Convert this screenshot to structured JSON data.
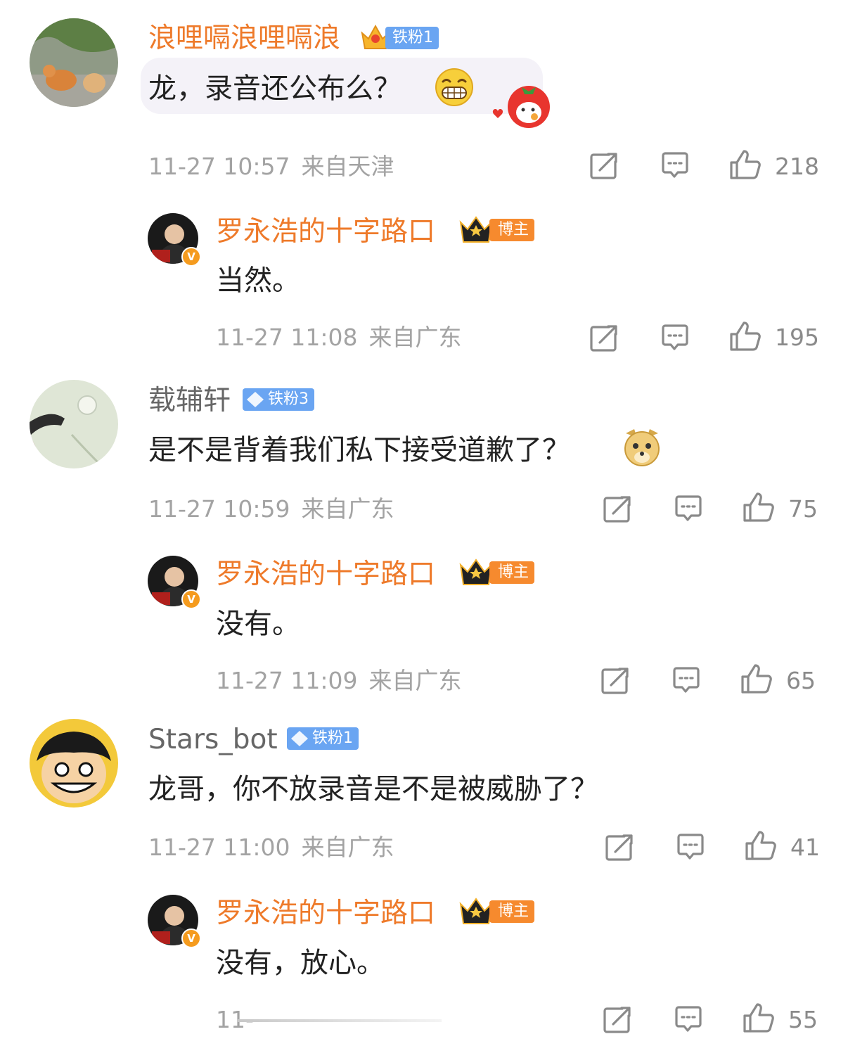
{
  "comments": [
    {
      "user": "浪哩嗝浪哩嗝浪",
      "badge": "铁粉1",
      "text": "龙，录音还公布么？",
      "time": "11-27 10:57",
      "location": "来自天津",
      "likes": "218",
      "reply": {
        "user": "罗永浩的十字路口",
        "badge": "博主",
        "text": "当然。",
        "time": "11-27 11:08",
        "location": "来自广东",
        "likes": "195"
      }
    },
    {
      "user": "载辅轩",
      "badge": "铁粉3",
      "text": "是不是背着我们私下接受道歉了？",
      "time": "11-27 10:59",
      "location": "来自广东",
      "likes": "75",
      "reply": {
        "user": "罗永浩的十字路口",
        "badge": "博主",
        "text": "没有。",
        "time": "11-27 11:09",
        "location": "来自广东",
        "likes": "65"
      }
    },
    {
      "user": "Stars_bot",
      "badge": "铁粉1",
      "text": "龙哥，你不放录音是不是被威胁了？",
      "time": "11-27 11:00",
      "location": "来自广东",
      "likes": "41",
      "reply": {
        "user": "罗永浩的十字路口",
        "badge": "博主",
        "text": "没有，放心。",
        "time": "11-",
        "location": "",
        "likes": "55"
      }
    }
  ],
  "avatar_badge": "V",
  "icons": [
    "repost-icon",
    "comment-icon",
    "like-icon",
    "v-verified-icon",
    "crown-icon",
    "diamond-icon"
  ],
  "colors": {
    "name_orange": "#ee7a2a",
    "badge_blue": "#6aa5f2",
    "badge_orange": "#f68a2e",
    "meta_gray": "#a3a3a3"
  }
}
